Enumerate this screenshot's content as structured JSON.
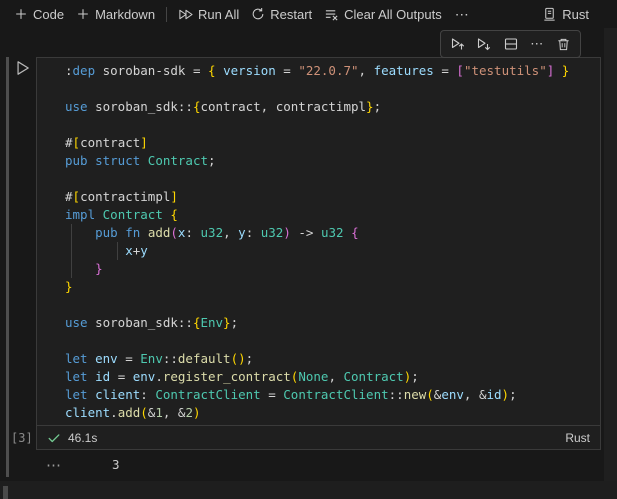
{
  "colors": {
    "page_bg": "#181818",
    "editor_bg": "#1f1f1f",
    "cell_border": "#3a3a3a",
    "toolbar_fg": "#cccccc",
    "success_green": "#73c991",
    "exec_count_gray": "#8a8a8a"
  },
  "toolbar": {
    "add_code": "Code",
    "add_markdown": "Markdown",
    "run_all": "Run All",
    "restart": "Restart",
    "clear_all_outputs": "Clear All Outputs",
    "more_label": "⋯",
    "kernel_name": "Rust"
  },
  "cell_toolbar": {
    "icons": [
      "execute-above",
      "execute-below",
      "split-cell",
      "more-actions",
      "delete-cell"
    ],
    "more_label": "⋯"
  },
  "cell": {
    "execution_count": "[3]",
    "status": {
      "duration": "46.1s",
      "language": "Rust"
    },
    "code": {
      "token_colors": {
        "txt": "#d4d4d4",
        "kw": "#569cd6",
        "var": "#9cdcfe",
        "type": "#4ec9b0",
        "fn": "#dcdcaa",
        "str": "#ce9178",
        "num": "#b5cea8",
        "b1": "#ffd700",
        "b2": "#da70d6"
      },
      "lines": [
        [
          [
            "txt",
            ":"
          ],
          [
            "kw",
            "dep"
          ],
          [
            "txt",
            " soroban-sdk = "
          ],
          [
            "b1",
            "{"
          ],
          [
            "txt",
            " "
          ],
          [
            "var",
            "version"
          ],
          [
            "txt",
            " = "
          ],
          [
            "str",
            "\"22.0.7\""
          ],
          [
            "txt",
            ", "
          ],
          [
            "var",
            "features"
          ],
          [
            "txt",
            " = "
          ],
          [
            "b2",
            "["
          ],
          [
            "str",
            "\"testutils\""
          ],
          [
            "b2",
            "]"
          ],
          [
            "txt",
            " "
          ],
          [
            "b1",
            "}"
          ]
        ],
        [],
        [
          [
            "kw",
            "use"
          ],
          [
            "txt",
            " soroban_sdk::"
          ],
          [
            "b1",
            "{"
          ],
          [
            "txt",
            "contract, contractimpl"
          ],
          [
            "b1",
            "}"
          ],
          [
            "txt",
            ";"
          ]
        ],
        [],
        [
          [
            "txt",
            "#"
          ],
          [
            "b1",
            "["
          ],
          [
            "txt",
            "contract"
          ],
          [
            "b1",
            "]"
          ]
        ],
        [
          [
            "kw",
            "pub"
          ],
          [
            "txt",
            " "
          ],
          [
            "kw",
            "struct"
          ],
          [
            "txt",
            " "
          ],
          [
            "type",
            "Contract"
          ],
          [
            "txt",
            ";"
          ]
        ],
        [],
        [
          [
            "txt",
            "#"
          ],
          [
            "b1",
            "["
          ],
          [
            "txt",
            "contractimpl"
          ],
          [
            "b1",
            "]"
          ]
        ],
        [
          [
            "kw",
            "impl"
          ],
          [
            "txt",
            " "
          ],
          [
            "type",
            "Contract"
          ],
          [
            "txt",
            " "
          ],
          [
            "b1",
            "{"
          ]
        ],
        [
          [
            "txt",
            "    "
          ],
          [
            "kw",
            "pub"
          ],
          [
            "txt",
            " "
          ],
          [
            "kw",
            "fn"
          ],
          [
            "txt",
            " "
          ],
          [
            "fn",
            "add"
          ],
          [
            "b2",
            "("
          ],
          [
            "var",
            "x"
          ],
          [
            "txt",
            ": "
          ],
          [
            "type",
            "u32"
          ],
          [
            "txt",
            ", "
          ],
          [
            "var",
            "y"
          ],
          [
            "txt",
            ": "
          ],
          [
            "type",
            "u32"
          ],
          [
            "b2",
            ")"
          ],
          [
            "txt",
            " -> "
          ],
          [
            "type",
            "u32"
          ],
          [
            "txt",
            " "
          ],
          [
            "b2",
            "{"
          ]
        ],
        [
          [
            "txt",
            "        "
          ],
          [
            "var",
            "x"
          ],
          [
            "txt",
            "+"
          ],
          [
            "var",
            "y"
          ]
        ],
        [
          [
            "txt",
            "    "
          ],
          [
            "b2",
            "}"
          ]
        ],
        [
          [
            "b1",
            "}"
          ]
        ],
        [],
        [
          [
            "kw",
            "use"
          ],
          [
            "txt",
            " soroban_sdk::"
          ],
          [
            "b1",
            "{"
          ],
          [
            "type",
            "Env"
          ],
          [
            "b1",
            "}"
          ],
          [
            "txt",
            ";"
          ]
        ],
        [],
        [
          [
            "kw",
            "let"
          ],
          [
            "txt",
            " "
          ],
          [
            "var",
            "env"
          ],
          [
            "txt",
            " = "
          ],
          [
            "type",
            "Env"
          ],
          [
            "txt",
            "::"
          ],
          [
            "fn",
            "default"
          ],
          [
            "b1",
            "("
          ],
          [
            "b1",
            ")"
          ],
          [
            "txt",
            ";"
          ]
        ],
        [
          [
            "kw",
            "let"
          ],
          [
            "txt",
            " "
          ],
          [
            "var",
            "id"
          ],
          [
            "txt",
            " = "
          ],
          [
            "var",
            "env"
          ],
          [
            "txt",
            "."
          ],
          [
            "fn",
            "register_contract"
          ],
          [
            "b1",
            "("
          ],
          [
            "type",
            "None"
          ],
          [
            "txt",
            ", "
          ],
          [
            "type",
            "Contract"
          ],
          [
            "b1",
            ")"
          ],
          [
            "txt",
            ";"
          ]
        ],
        [
          [
            "kw",
            "let"
          ],
          [
            "txt",
            " "
          ],
          [
            "var",
            "client"
          ],
          [
            "txt",
            ": "
          ],
          [
            "type",
            "ContractClient"
          ],
          [
            "txt",
            " = "
          ],
          [
            "type",
            "ContractClient"
          ],
          [
            "txt",
            "::"
          ],
          [
            "fn",
            "new"
          ],
          [
            "b1",
            "("
          ],
          [
            "txt",
            "&"
          ],
          [
            "var",
            "env"
          ],
          [
            "txt",
            ", &"
          ],
          [
            "var",
            "id"
          ],
          [
            "b1",
            ")"
          ],
          [
            "txt",
            ";"
          ]
        ],
        [
          [
            "var",
            "client"
          ],
          [
            "txt",
            "."
          ],
          [
            "fn",
            "add"
          ],
          [
            "b1",
            "("
          ],
          [
            "txt",
            "&"
          ],
          [
            "num",
            "1"
          ],
          [
            "txt",
            ", &"
          ],
          [
            "num",
            "2"
          ],
          [
            "b1",
            ")"
          ]
        ]
      ]
    }
  },
  "output": {
    "menu_label": "⋯",
    "value": "3"
  }
}
